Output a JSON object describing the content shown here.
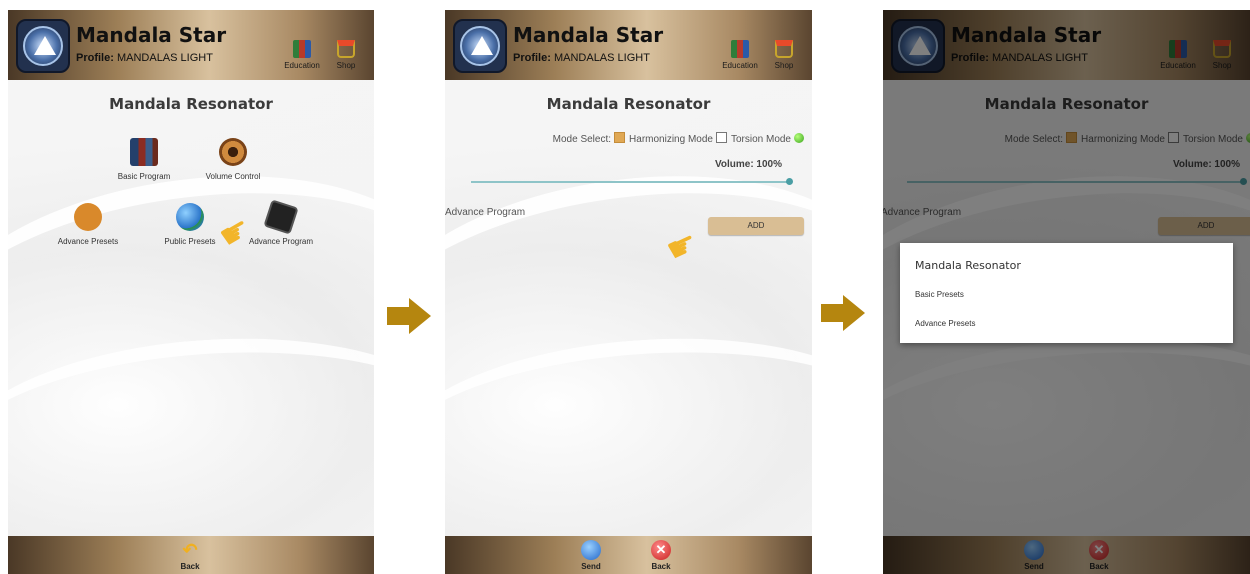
{
  "app": {
    "title": "Mandala Star",
    "profile_prefix": "Profile:",
    "profile_name": "MANDALAS LIGHT"
  },
  "topbar": {
    "education_label": "Education",
    "shop_label": "Shop"
  },
  "screen1": {
    "title": "Mandala Resonator",
    "items": {
      "basic_program": "Basic Program",
      "volume_control": "Volume Control",
      "advance_presets": "Advance Presets",
      "public_presets": "Public Presets",
      "advance_program": "Advance Program"
    },
    "back_label": "Back"
  },
  "screen2": {
    "title": "Mandala Resonator",
    "mode_select_label": "Mode Select:",
    "harmonizing_mode_label": "Harmonizing Mode",
    "torsion_mode_label": "Torsion Mode",
    "volume_label": "Volume: 100%",
    "advance_program_label": "Advance Program",
    "add_label": "ADD",
    "send_label": "Send",
    "back_label": "Back"
  },
  "screen3": {
    "title": "Mandala Resonator",
    "mode_select_label": "Mode Select:",
    "harmonizing_mode_label": "Harmonizing Mode",
    "torsion_mode_label": "Torsion Mode",
    "volume_label": "Volume: 100%",
    "advance_program_label": "Advance Program",
    "add_label": "ADD",
    "dialog": {
      "title": "Mandala Resonator",
      "items": [
        "Basic Presets",
        "Advance Presets"
      ]
    },
    "send_label": "Send",
    "back_label": "Back"
  },
  "colors": {
    "accent": "#b5860f",
    "button": "#d9be94",
    "slider": "#8ec4c8"
  },
  "volume_level": 1.0
}
